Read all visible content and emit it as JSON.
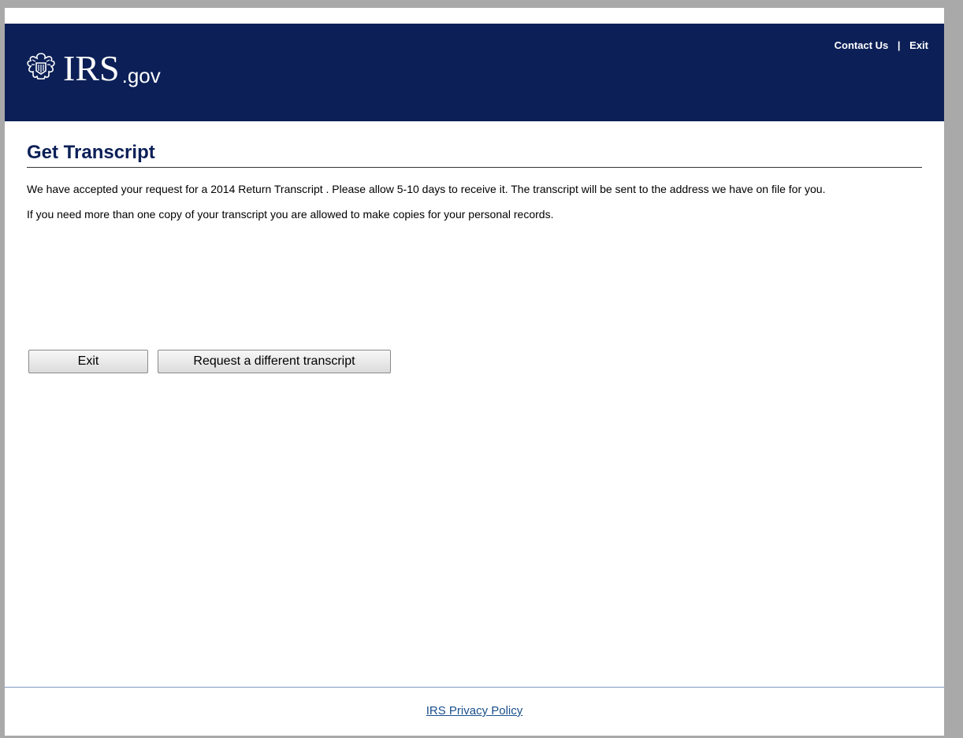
{
  "header": {
    "logo_main": "IRS",
    "logo_suffix": ".gov",
    "links": {
      "contact": "Contact Us",
      "separator": "|",
      "exit": "Exit"
    }
  },
  "main": {
    "title": "Get Transcript",
    "paragraph1": "We have accepted your request for a 2014 Return Transcript . Please allow 5-10 days to receive it. The transcript will be sent to the address we have on file for you.",
    "paragraph2": "If you need more than one copy of your transcript you are allowed to make copies for your personal records."
  },
  "buttons": {
    "exit_label": "Exit",
    "request_label": "Request a different transcript"
  },
  "footer": {
    "privacy_link": "IRS Privacy Policy"
  },
  "colors": {
    "header_bg": "#0c2057",
    "title": "#0c2057",
    "footer_link": "#1a4f8c",
    "frame_bg": "#a9a9a9"
  },
  "icons": {
    "logo": "irs-eagle-icon"
  }
}
